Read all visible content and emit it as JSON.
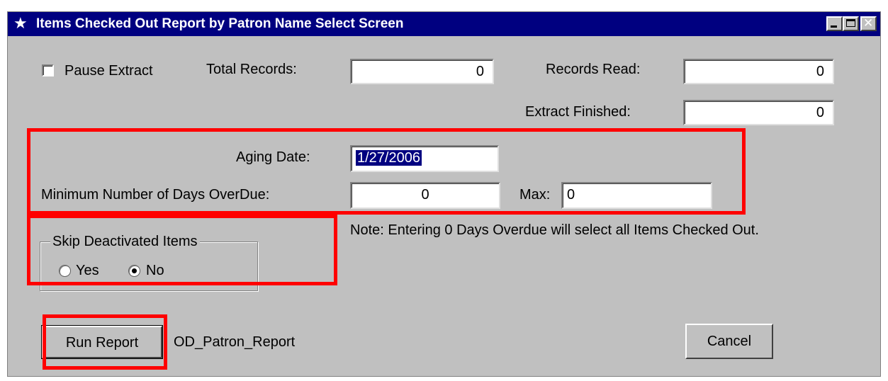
{
  "window": {
    "title": "Items Checked Out Report by Patron Name  Select Screen",
    "icon": "star-person-icon"
  },
  "extract": {
    "pause_label": "Pause Extract",
    "pause_checked": false,
    "total_records_label": "Total Records:",
    "total_records_value": "0",
    "records_read_label": "Records Read:",
    "records_read_value": "0",
    "extract_finished_label": "Extract Finished:",
    "extract_finished_value": "0"
  },
  "criteria": {
    "aging_date_label": "Aging Date:",
    "aging_date_value": "1/27/2006",
    "min_days_label": "Minimum Number of Days OverDue:",
    "min_days_value": "0",
    "max_label": "Max:",
    "max_value": "0",
    "note": "Note: Entering 0 Days Overdue will select all Items Checked Out."
  },
  "skip_deactivated": {
    "legend": "Skip Deactivated Items",
    "yes_label": "Yes",
    "no_label": "No",
    "selected": "No"
  },
  "actions": {
    "run_label": "Run Report",
    "report_name": "OD_Patron_Report",
    "cancel_label": "Cancel"
  },
  "colors": {
    "titlebar": "#000080",
    "window_bg": "#c0c0c0",
    "highlight": "#ff0000",
    "selection": "#000080"
  }
}
